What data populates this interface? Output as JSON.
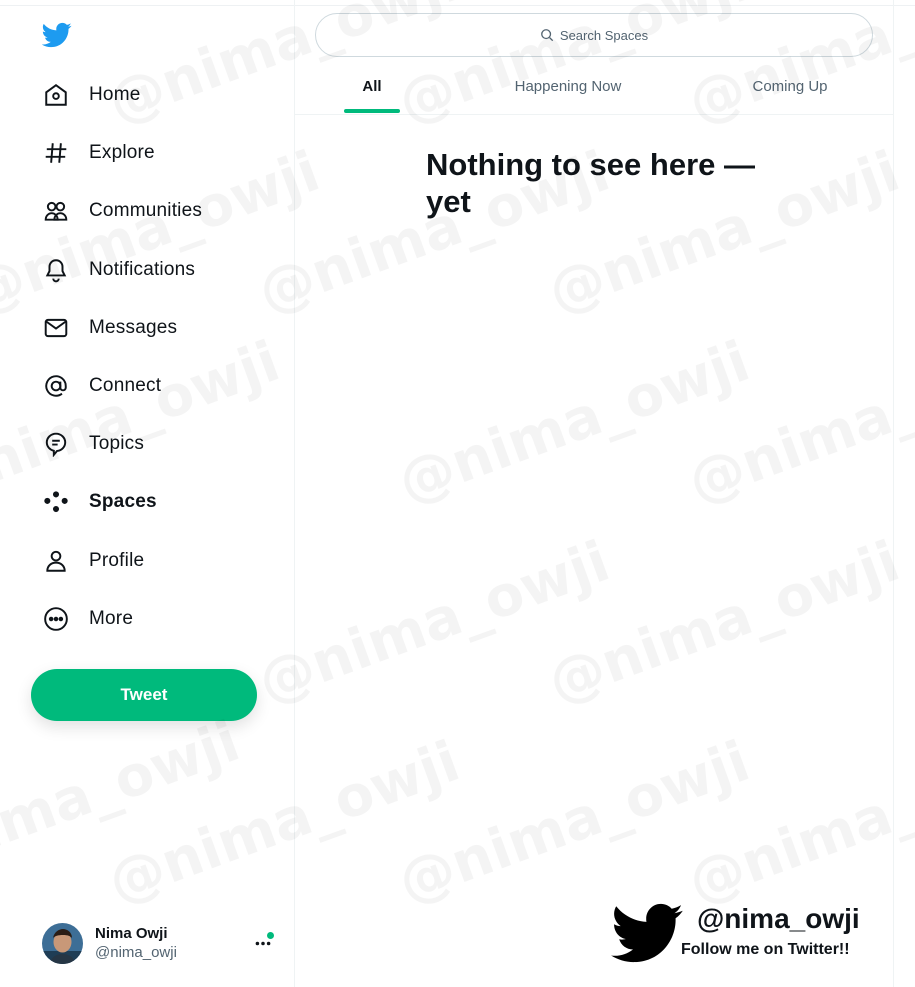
{
  "sidebar": {
    "logo_icon": "twitter-bird-icon",
    "items": [
      {
        "label": "Home",
        "icon": "home-icon"
      },
      {
        "label": "Explore",
        "icon": "hashtag-icon"
      },
      {
        "label": "Communities",
        "icon": "communities-icon"
      },
      {
        "label": "Notifications",
        "icon": "bell-icon"
      },
      {
        "label": "Messages",
        "icon": "envelope-icon"
      },
      {
        "label": "Connect",
        "icon": "at-icon"
      },
      {
        "label": "Topics",
        "icon": "topics-icon"
      },
      {
        "label": "Spaces",
        "icon": "spaces-icon",
        "active": true
      },
      {
        "label": "Profile",
        "icon": "person-icon"
      },
      {
        "label": "More",
        "icon": "more-circle-icon"
      }
    ],
    "tweet_button": "Tweet",
    "account": {
      "name": "Nima Owji",
      "handle": "@nima_owji",
      "more_icon": "ellipsis-icon"
    }
  },
  "main": {
    "search": {
      "placeholder": "Search Spaces",
      "icon": "search-icon"
    },
    "tabs": [
      {
        "label": "All",
        "active": true
      },
      {
        "label": "Happening Now"
      },
      {
        "label": "Coming Up"
      }
    ],
    "empty_title": "Nothing to see here — yet"
  },
  "promo": {
    "handle": "@nima_owji",
    "subtitle": "Follow me on Twitter!!"
  },
  "watermark": "@nima_owji",
  "colors": {
    "accent": "#00ba7c",
    "text": "#0f1419",
    "secondary": "#536471",
    "twitter_blue": "#1d9bf0"
  }
}
